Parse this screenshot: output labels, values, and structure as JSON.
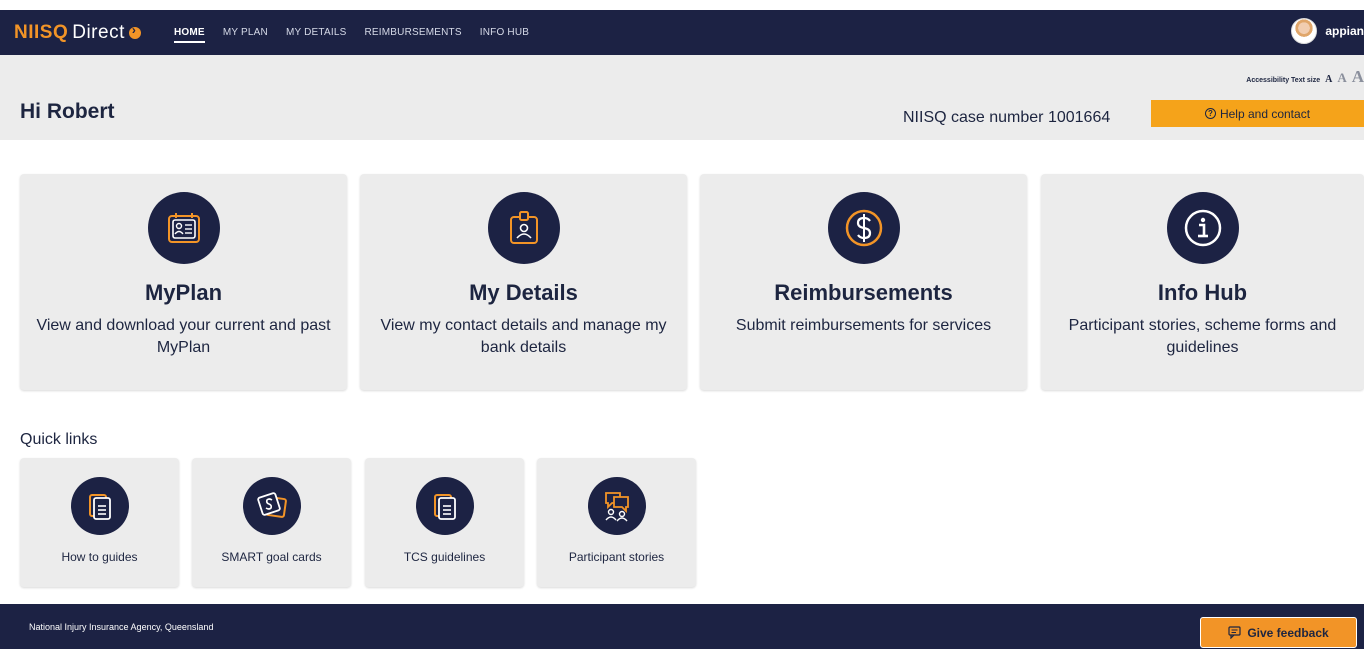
{
  "nav": {
    "logo_niisq": "NIISQ",
    "logo_direct": "Direct",
    "links": [
      {
        "label": "HOME",
        "active": true
      },
      {
        "label": "MY PLAN",
        "active": false
      },
      {
        "label": "MY DETAILS",
        "active": false
      },
      {
        "label": "REIMBURSEMENTS",
        "active": false
      },
      {
        "label": "INFO HUB",
        "active": false
      }
    ],
    "username": "appian"
  },
  "accessibility": {
    "label": "Accessibility Text size",
    "small": "A",
    "medium": "A",
    "large": "A"
  },
  "header": {
    "greeting": "Hi Robert",
    "case_number": "NIISQ case number 1001664",
    "help_label": "Help and contact"
  },
  "cards": [
    {
      "icon": "plan-calendar-icon",
      "title": "MyPlan",
      "description": "View and download your current and past MyPlan"
    },
    {
      "icon": "id-badge-icon",
      "title": "My Details",
      "description": "View my contact details and manage my bank details"
    },
    {
      "icon": "dollar-icon",
      "title": "Reimbursements",
      "description": "Submit reimbursements for services"
    },
    {
      "icon": "info-icon",
      "title": "Info Hub",
      "description": "Participant stories, scheme forms and guidelines"
    }
  ],
  "quick_links": {
    "title": "Quick links",
    "items": [
      {
        "icon": "documents-icon",
        "label": "How to guides"
      },
      {
        "icon": "goal-cards-icon",
        "label": "SMART goal cards"
      },
      {
        "icon": "documents-icon",
        "label": "TCS guidelines"
      },
      {
        "icon": "chat-people-icon",
        "label": "Participant stories"
      }
    ]
  },
  "footer": {
    "agency": "National Injury Insurance Agency, Queensland",
    "feedback_label": "Give feedback"
  },
  "colors": {
    "navy": "#1c2244",
    "orange": "#f29427",
    "help_yellow": "#f5a31a",
    "band_grey": "#ececec"
  }
}
